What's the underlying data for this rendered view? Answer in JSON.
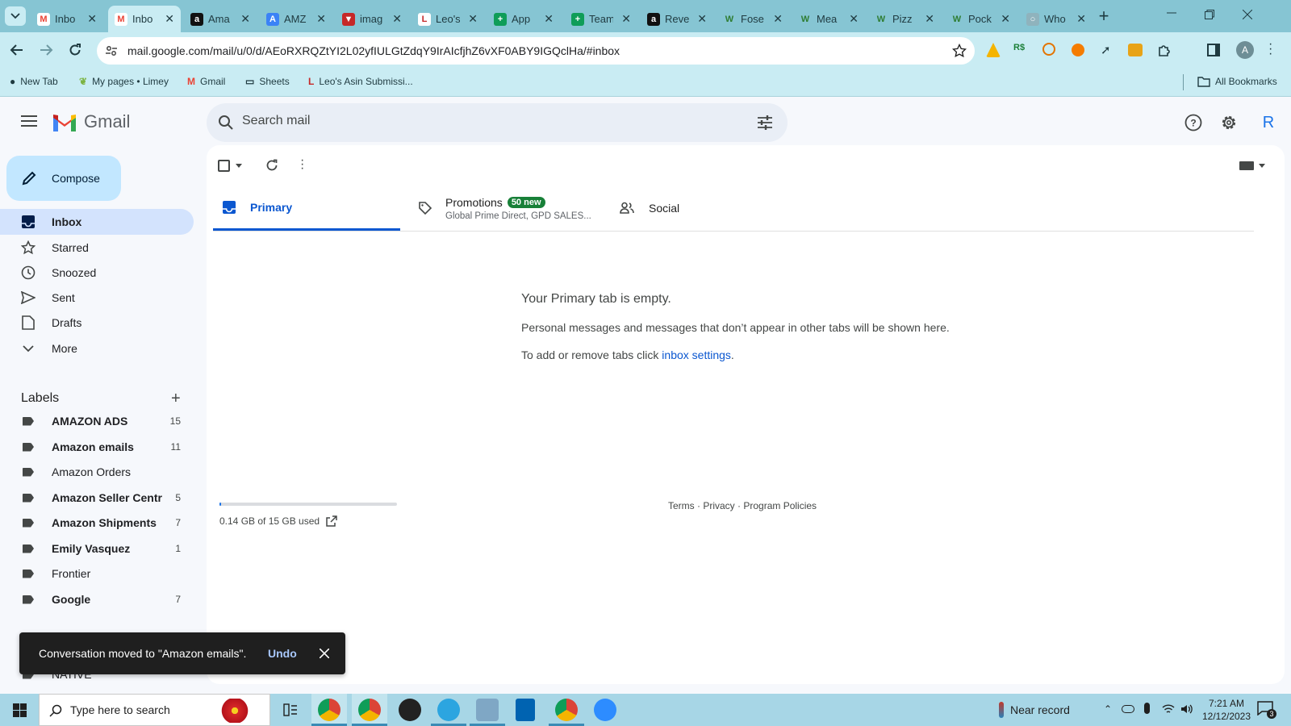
{
  "browser": {
    "tabs": [
      {
        "title": "Inbo",
        "icon": "gmail-icon",
        "active": false
      },
      {
        "title": "Inbo",
        "icon": "gmail-icon",
        "active": true
      },
      {
        "title": "Ama",
        "icon": "amazon-icon",
        "active": false
      },
      {
        "title": "AMZ",
        "icon": "amz-icon",
        "active": false
      },
      {
        "title": "imag",
        "icon": "image-icon",
        "active": false
      },
      {
        "title": "Leo's",
        "icon": "leo-icon",
        "active": false
      },
      {
        "title": "App",
        "icon": "sheets-icon",
        "active": false
      },
      {
        "title": "Team",
        "icon": "sheets-icon",
        "active": false
      },
      {
        "title": "Reve",
        "icon": "amazon-icon",
        "active": false
      },
      {
        "title": "Fose",
        "icon": "w-icon",
        "active": false
      },
      {
        "title": "Mea",
        "icon": "w-icon",
        "active": false
      },
      {
        "title": "Pizz",
        "icon": "w-icon",
        "active": false
      },
      {
        "title": "Pock",
        "icon": "w-icon",
        "active": false
      },
      {
        "title": "Who",
        "icon": "globe-icon",
        "active": false
      }
    ],
    "url": "mail.google.com/mail/u/0/d/AEoRXRQZtYI2L02yfIULGtZdqY9IrAIcfjhZ6vXF0ABY9IGQclHa/#inbox",
    "bookmarks": [
      {
        "label": "New Tab",
        "icon": "globe-icon"
      },
      {
        "label": "My pages • Limey",
        "icon": "leaf-icon"
      },
      {
        "label": "Gmail",
        "icon": "gmail-icon"
      },
      {
        "label": "Sheets",
        "icon": "folder-icon"
      },
      {
        "label": "Leo's Asin Submissi...",
        "icon": "leo-icon"
      }
    ],
    "all_bookmarks": "All Bookmarks",
    "profile_initial": "A"
  },
  "gmail": {
    "logo_text": "Gmail",
    "search_placeholder": "Search mail",
    "account_initial": "R",
    "compose_label": "Compose",
    "nav": [
      {
        "label": "Inbox",
        "icon": "inbox-icon",
        "active": true
      },
      {
        "label": "Starred",
        "icon": "star-icon"
      },
      {
        "label": "Snoozed",
        "icon": "clock-icon"
      },
      {
        "label": "Sent",
        "icon": "send-icon"
      },
      {
        "label": "Drafts",
        "icon": "draft-icon"
      },
      {
        "label": "More",
        "icon": "chevron-down-icon"
      }
    ],
    "labels_heading": "Labels",
    "labels": [
      {
        "name": "AMAZON ADS",
        "count": "15",
        "bold": true
      },
      {
        "name": "Amazon emails",
        "count": "11",
        "bold": true
      },
      {
        "name": "Amazon Orders",
        "count": "",
        "bold": false
      },
      {
        "name": "Amazon Seller Centr",
        "count": "5",
        "bold": true
      },
      {
        "name": "Amazon Shipments",
        "count": "7",
        "bold": true
      },
      {
        "name": "Emily Vasquez",
        "count": "1",
        "bold": true
      },
      {
        "name": "Frontier",
        "count": "",
        "bold": false
      },
      {
        "name": "Google",
        "count": "7",
        "bold": true
      },
      {
        "name": "NATIVE",
        "count": "",
        "bold": false
      }
    ],
    "tabs": {
      "primary": "Primary",
      "promotions": "Promotions",
      "promotions_badge": "50 new",
      "promotions_snippet": "Global Prime Direct, GPD SALES...",
      "social": "Social"
    },
    "empty": {
      "heading": "Your Primary tab is empty.",
      "line1": "Personal messages and messages that don’t appear in other tabs will be shown here.",
      "line2_prefix": "To add or remove tabs click ",
      "line2_link": "inbox settings",
      "line2_suffix": "."
    },
    "storage": {
      "text": "0.14 GB of 15 GB used",
      "fraction_used": 0.0093
    },
    "footer": {
      "terms": "Terms",
      "privacy": "Privacy",
      "policies": "Program Policies",
      "sep": " · "
    },
    "snackbar": {
      "message": "Conversation moved to \"Amazon emails\".",
      "undo": "Undo"
    }
  },
  "taskbar": {
    "search_placeholder": "Type here to search",
    "weather": "Near record",
    "time": "7:21 AM",
    "date": "12/12/2023",
    "notification_count": "3"
  },
  "colors": {
    "accent": "#0b57d0",
    "promo_badge": "#188038",
    "gmail_red": "#ea4335"
  }
}
